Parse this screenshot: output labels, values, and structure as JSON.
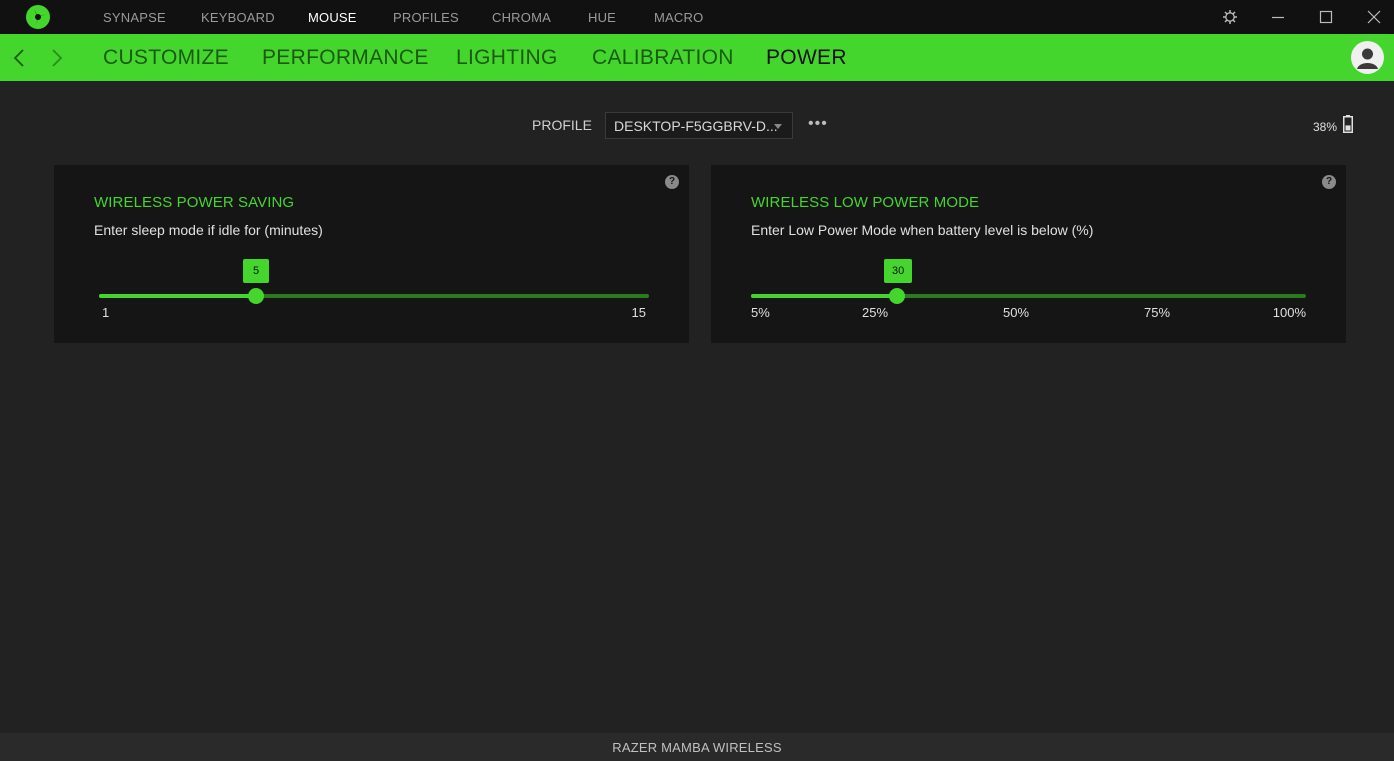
{
  "titlebar": {
    "nav": [
      {
        "label": "SYNAPSE",
        "active": false
      },
      {
        "label": "KEYBOARD",
        "active": false
      },
      {
        "label": "MOUSE",
        "active": true
      },
      {
        "label": "PROFILES",
        "active": false
      },
      {
        "label": "CHROMA",
        "active": false
      },
      {
        "label": "HUE",
        "active": false
      },
      {
        "label": "MACRO",
        "active": false
      }
    ],
    "icons": [
      "razer-logo-icon",
      "gear-icon",
      "minimize-icon",
      "maximize-icon",
      "close-icon"
    ]
  },
  "subnav": {
    "tabs": [
      {
        "label": "CUSTOMIZE",
        "active": false
      },
      {
        "label": "PERFORMANCE",
        "active": false
      },
      {
        "label": "LIGHTING",
        "active": false
      },
      {
        "label": "CALIBRATION",
        "active": false
      },
      {
        "label": "POWER",
        "active": true
      }
    ],
    "accent": "#44d62c"
  },
  "profile": {
    "label": "PROFILE",
    "selected": "DESKTOP-F5GGBRV-D...",
    "more": "•••"
  },
  "battery": {
    "percent_label": "38%",
    "level": 0.38
  },
  "panels": {
    "power_saving": {
      "title": "WIRELESS POWER SAVING",
      "description": "Enter sleep mode if idle for (minutes)",
      "value": 5,
      "value_label": "5",
      "min": 1,
      "max": 15,
      "min_label": "1",
      "max_label": "15",
      "help": "?"
    },
    "low_power": {
      "title": "WIRELESS LOW POWER MODE",
      "description": "Enter Low Power Mode when battery level is below (%)",
      "value": 30,
      "value_label": "30",
      "min": 5,
      "max": 100,
      "ticks": [
        "5%",
        "25%",
        "50%",
        "75%",
        "100%"
      ],
      "help": "?"
    }
  },
  "footer": {
    "device": "RAZER MAMBA WIRELESS"
  }
}
